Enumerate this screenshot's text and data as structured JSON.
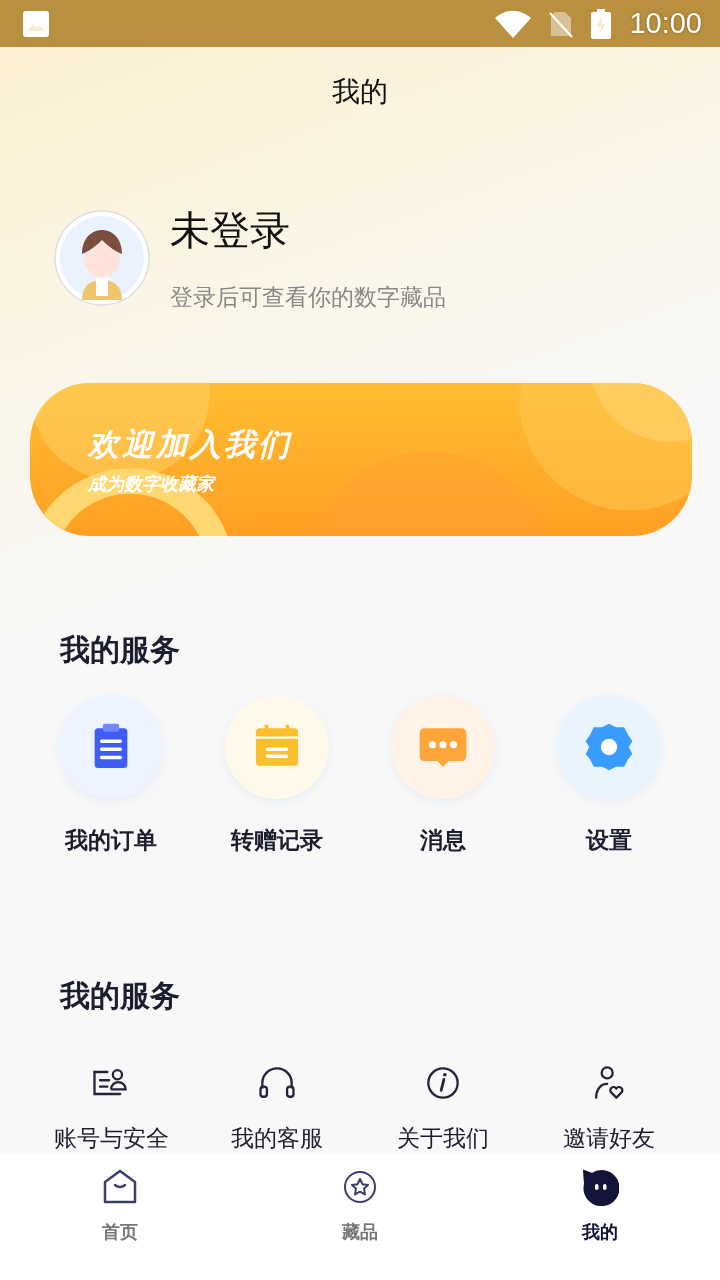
{
  "status_bar": {
    "time": "10:00"
  },
  "header": {
    "title": "我的"
  },
  "profile": {
    "name": "未登录",
    "hint": "登录后可查看你的数字藏品"
  },
  "banner": {
    "title": "欢迎加入我们",
    "subtitle": "成为数字收藏家"
  },
  "services": {
    "title": "我的服务",
    "items": [
      {
        "kind": "orders",
        "label": "我的订单"
      },
      {
        "kind": "transfers",
        "label": "转赠记录"
      },
      {
        "kind": "messages",
        "label": "消息"
      },
      {
        "kind": "settings",
        "label": "设置"
      }
    ]
  },
  "more_services": {
    "title": "我的服务",
    "items": [
      {
        "kind": "account",
        "label": "账号与安全"
      },
      {
        "kind": "support",
        "label": "我的客服"
      },
      {
        "kind": "about",
        "label": "关于我们"
      },
      {
        "kind": "invite",
        "label": "邀请好友"
      }
    ]
  },
  "tab_bar": [
    {
      "kind": "home",
      "label": "首页",
      "selected": false
    },
    {
      "kind": "collection",
      "label": "藏品",
      "selected": false
    },
    {
      "kind": "profile",
      "label": "我的",
      "selected": true
    }
  ]
}
